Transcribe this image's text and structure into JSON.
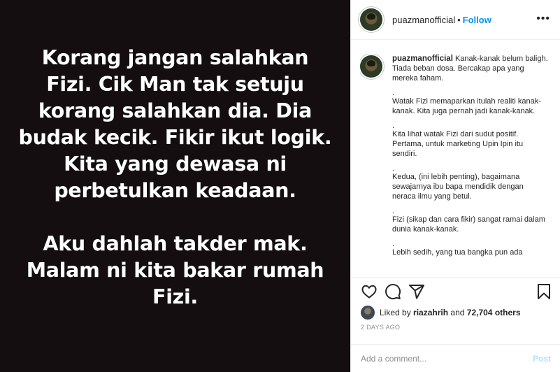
{
  "media": {
    "paragraph1": "Korang jangan salahkan\nFizi. Cik Man tak setuju\nkorang salahkan dia. Dia\nbudak kecik. Fikir ikut logik.\nKita yang dewasa ni\nperbetulkan keadaan.",
    "paragraph2": "Aku dahlah takder mak.\nMalam ni kita bakar rumah\nFizi."
  },
  "header": {
    "username": "puazmanofficial",
    "dot": "•",
    "follow_label": "Follow",
    "more_label": "•••"
  },
  "caption": {
    "username": "puazmanofficial",
    "lines": [
      "Kanak-kanak belum baligh. Tiada beban dosa. Bercakap apa yang mereka faham.",
      ".",
      "Watak Fizi memaparkan itulah realiti kanak-kanak. Kita juga pernah jadi kanak-kanak.",
      ".",
      "Kita lihat watak Fizi dari sudut positif. Pertama, untuk marketing Upin Ipin itu sendiri.",
      ".",
      "Kedua, (ini lebih penting), bagaimana sewajarnya ibu bapa mendidik dengan neraca ilmu yang betul.",
      ".",
      "Fizi (sikap dan cara fikir) sangat ramai dalam dunia kanak-kanak.",
      ".",
      "Lebih sedih, yang tua bangka pun ada"
    ]
  },
  "likes": {
    "prefix": "Liked by",
    "user": "riazahrih",
    "middle": "and",
    "count": "72,704 others"
  },
  "timestamp": "2 DAYS AGO",
  "comment": {
    "placeholder": "Add a comment...",
    "post_label": "Post"
  },
  "colors": {
    "accent": "#0095f6",
    "media_bg": "#140e10",
    "post_disabled": "#b2dffc"
  },
  "icons": [
    "heart-icon",
    "comment-icon",
    "share-icon",
    "bookmark-icon"
  ]
}
